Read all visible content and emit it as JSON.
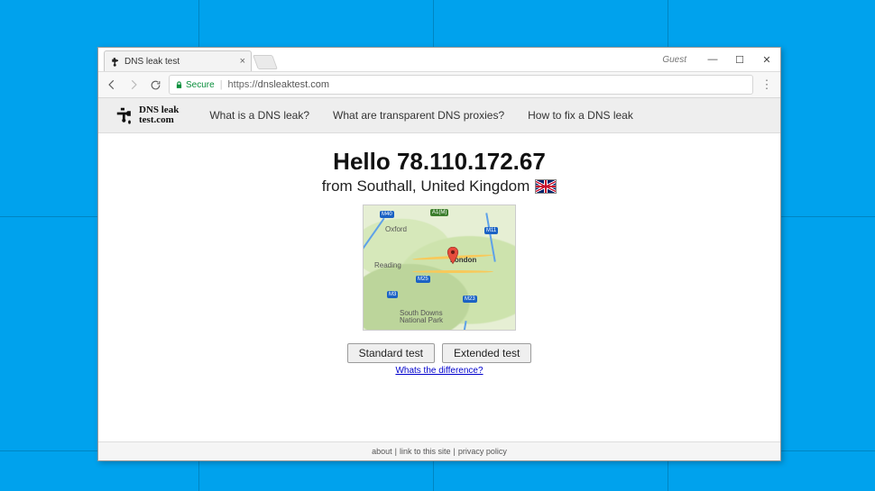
{
  "window": {
    "guest_label": "Guest",
    "minimize_glyph": "—",
    "maximize_glyph": "☐",
    "close_glyph": "✕"
  },
  "tab": {
    "title": "DNS leak test",
    "close_glyph": "×"
  },
  "addressbar": {
    "secure_label": "Secure",
    "scheme": "https://",
    "host": "dnsleaktest.com"
  },
  "nav": {
    "logo_line1": "DNS leak",
    "logo_line2": "test.com",
    "links": [
      "What is a DNS leak?",
      "What are transparent DNS proxies?",
      "How to fix a DNS leak"
    ]
  },
  "main": {
    "hello_prefix": "Hello ",
    "ip": "78.110.172.67",
    "from_prefix": "from ",
    "location": "Southall, United Kingdom",
    "standard_btn": "Standard test",
    "extended_btn": "Extended test",
    "difference_link": "Whats the difference?"
  },
  "map": {
    "badges": {
      "m40": "M40",
      "a1m": "A1(M)",
      "m11": "M11",
      "m25": "M25",
      "m23": "M23",
      "m3": "M3"
    },
    "labels": {
      "oxford": "Oxford",
      "reading": "Reading",
      "london": "London",
      "southdowns": "South Downs\nNational Park"
    }
  },
  "footer": {
    "about": "about",
    "link": "link to this site",
    "privacy": "privacy policy",
    "sep": " | "
  }
}
